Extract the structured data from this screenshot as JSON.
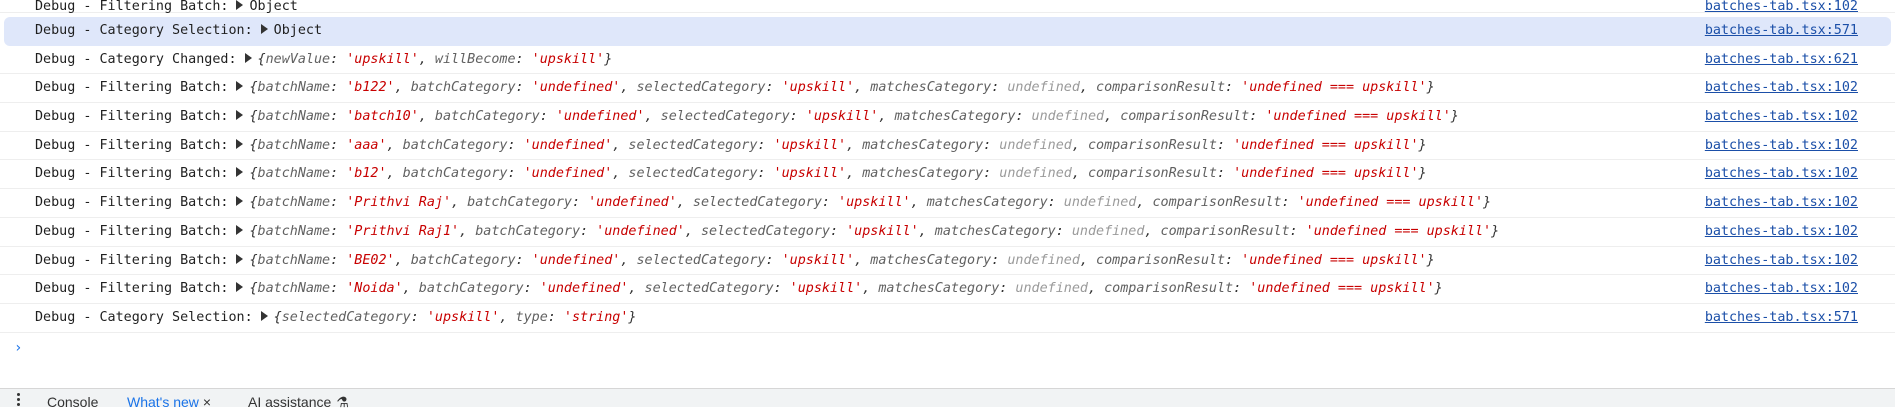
{
  "console": {
    "rows": [
      {
        "message": "Debug - Filtering Batch:",
        "summary": "Object",
        "source": "batches-tab.tsx:102"
      },
      {
        "message": "Debug - Category Selection:",
        "summary": "Object",
        "source": "batches-tab.tsx:571",
        "highlighted": true
      },
      {
        "message": "Debug - Category Changed:",
        "props": [
          {
            "k": "newValue",
            "v": "'upskill'",
            "t": "s"
          },
          {
            "k": "willBecome",
            "v": "'upskill'",
            "t": "s"
          }
        ],
        "source": "batches-tab.tsx:621"
      },
      {
        "message": "Debug - Filtering Batch:",
        "props": [
          {
            "k": "batchName",
            "v": "'b122'",
            "t": "s"
          },
          {
            "k": "batchCategory",
            "v": "'undefined'",
            "t": "s"
          },
          {
            "k": "selectedCategory",
            "v": "'upskill'",
            "t": "s"
          },
          {
            "k": "matchesCategory",
            "v": "undefined",
            "t": "u"
          },
          {
            "k": "comparisonResult",
            "v": "'undefined === upskill'",
            "t": "s"
          }
        ],
        "source": "batches-tab.tsx:102"
      },
      {
        "message": "Debug - Filtering Batch:",
        "props": [
          {
            "k": "batchName",
            "v": "'batch10'",
            "t": "s"
          },
          {
            "k": "batchCategory",
            "v": "'undefined'",
            "t": "s"
          },
          {
            "k": "selectedCategory",
            "v": "'upskill'",
            "t": "s"
          },
          {
            "k": "matchesCategory",
            "v": "undefined",
            "t": "u"
          },
          {
            "k": "comparisonResult",
            "v": "'undefined === upskill'",
            "t": "s"
          }
        ],
        "source": "batches-tab.tsx:102"
      },
      {
        "message": "Debug - Filtering Batch:",
        "props": [
          {
            "k": "batchName",
            "v": "'aaa'",
            "t": "s"
          },
          {
            "k": "batchCategory",
            "v": "'undefined'",
            "t": "s"
          },
          {
            "k": "selectedCategory",
            "v": "'upskill'",
            "t": "s"
          },
          {
            "k": "matchesCategory",
            "v": "undefined",
            "t": "u"
          },
          {
            "k": "comparisonResult",
            "v": "'undefined === upskill'",
            "t": "s"
          }
        ],
        "source": "batches-tab.tsx:102"
      },
      {
        "message": "Debug - Filtering Batch:",
        "props": [
          {
            "k": "batchName",
            "v": "'b12'",
            "t": "s"
          },
          {
            "k": "batchCategory",
            "v": "'undefined'",
            "t": "s"
          },
          {
            "k": "selectedCategory",
            "v": "'upskill'",
            "t": "s"
          },
          {
            "k": "matchesCategory",
            "v": "undefined",
            "t": "u"
          },
          {
            "k": "comparisonResult",
            "v": "'undefined === upskill'",
            "t": "s"
          }
        ],
        "source": "batches-tab.tsx:102"
      },
      {
        "message": "Debug - Filtering Batch:",
        "props": [
          {
            "k": "batchName",
            "v": "'Prithvi Raj'",
            "t": "s"
          },
          {
            "k": "batchCategory",
            "v": "'undefined'",
            "t": "s"
          },
          {
            "k": "selectedCategory",
            "v": "'upskill'",
            "t": "s"
          },
          {
            "k": "matchesCategory",
            "v": "undefined",
            "t": "u"
          },
          {
            "k": "comparisonResult",
            "v": "'undefined === upskill'",
            "t": "s"
          }
        ],
        "source": "batches-tab.tsx:102"
      },
      {
        "message": "Debug - Filtering Batch:",
        "props": [
          {
            "k": "batchName",
            "v": "'Prithvi Raj1'",
            "t": "s"
          },
          {
            "k": "batchCategory",
            "v": "'undefined'",
            "t": "s"
          },
          {
            "k": "selectedCategory",
            "v": "'upskill'",
            "t": "s"
          },
          {
            "k": "matchesCategory",
            "v": "undefined",
            "t": "u"
          },
          {
            "k": "comparisonResult",
            "v": "'undefined === upskill'",
            "t": "s"
          }
        ],
        "source": "batches-tab.tsx:102"
      },
      {
        "message": "Debug - Filtering Batch:",
        "props": [
          {
            "k": "batchName",
            "v": "'BE02'",
            "t": "s"
          },
          {
            "k": "batchCategory",
            "v": "'undefined'",
            "t": "s"
          },
          {
            "k": "selectedCategory",
            "v": "'upskill'",
            "t": "s"
          },
          {
            "k": "matchesCategory",
            "v": "undefined",
            "t": "u"
          },
          {
            "k": "comparisonResult",
            "v": "'undefined === upskill'",
            "t": "s"
          }
        ],
        "source": "batches-tab.tsx:102"
      },
      {
        "message": "Debug - Filtering Batch:",
        "props": [
          {
            "k": "batchName",
            "v": "'Noida'",
            "t": "s"
          },
          {
            "k": "batchCategory",
            "v": "'undefined'",
            "t": "s"
          },
          {
            "k": "selectedCategory",
            "v": "'upskill'",
            "t": "s"
          },
          {
            "k": "matchesCategory",
            "v": "undefined",
            "t": "u"
          },
          {
            "k": "comparisonResult",
            "v": "'undefined === upskill'",
            "t": "s"
          }
        ],
        "source": "batches-tab.tsx:102"
      },
      {
        "message": "Debug - Category Selection:",
        "props": [
          {
            "k": "selectedCategory",
            "v": "'upskill'",
            "t": "s"
          },
          {
            "k": "type",
            "v": "'string'",
            "t": "s"
          }
        ],
        "source": "batches-tab.tsx:571"
      }
    ],
    "prompt_symbol": "›"
  },
  "drawer": {
    "tabs": [
      {
        "label": "Console",
        "active": false
      },
      {
        "label": "What's new",
        "active": true,
        "closable": true
      },
      {
        "label": "AI assistance",
        "active": false,
        "icon": "flask-icon"
      }
    ],
    "close_symbol": "×",
    "flask_symbol": "⚗"
  },
  "colors": {
    "accent": "#1a73e8",
    "string": "#c80000",
    "undefined": "#9a9a9a",
    "link": "#1b4fa8",
    "highlight": "#dfe7fa"
  }
}
